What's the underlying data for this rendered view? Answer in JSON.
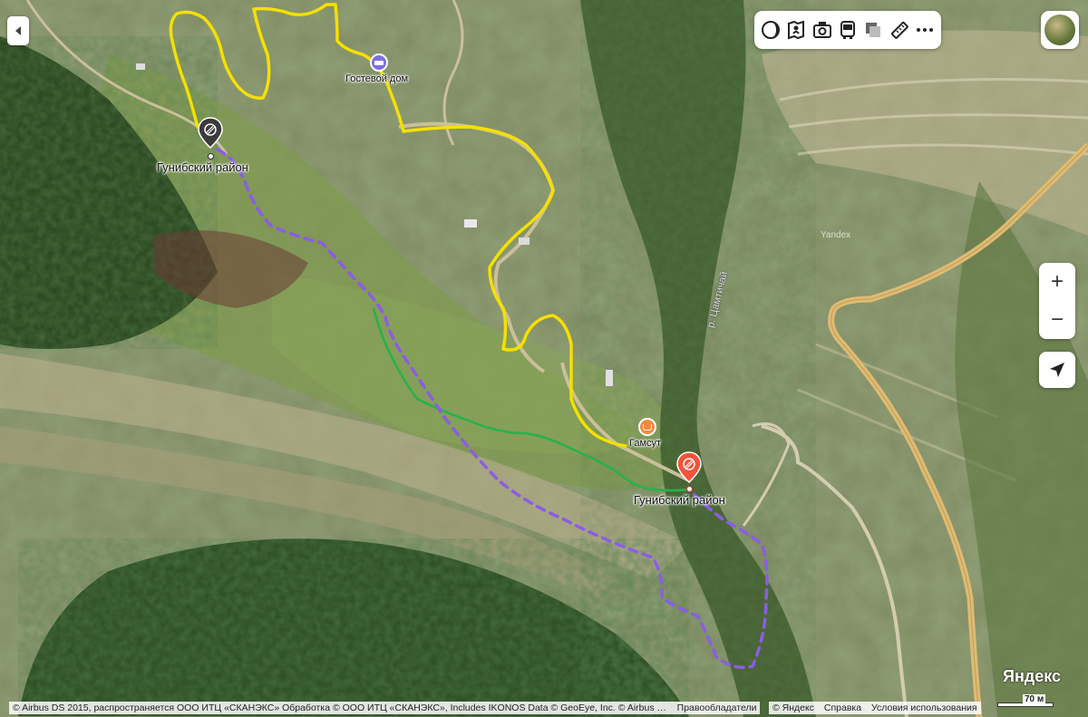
{
  "map": {
    "type": "satellite",
    "colors": {
      "route_yellow": "#f5e000",
      "route_green": "#24b34a",
      "route_purple": "#8c5ce6",
      "road_major": "#e0bb72",
      "pin_gray": "#3b3b3b",
      "pin_red": "#f1533b"
    }
  },
  "places": {
    "guest_house": "Гостевой дом",
    "gamsut": "Гамсут",
    "district_start": "Гунибский район",
    "district_end": "Гунибский район",
    "river": "р. Цамтичай",
    "watermark": "Yandex"
  },
  "controls": {
    "back_icon": "triangle-left-icon",
    "toolbar_icons": [
      "layers-icon",
      "panorama-icon",
      "photo-camera-icon",
      "transport-bus-icon",
      "map-mode-icon",
      "ruler-icon",
      "more-icon"
    ],
    "zoom_in": "+",
    "zoom_out": "−",
    "locate_icon": "location-arrow-icon"
  },
  "footer": {
    "attribution": "© Airbus DS 2015, распространяется ООО ИТЦ «СКАНЭКС» Обработка © ООО ИТЦ «СКАНЭКС», Includes IKONOS Data © GeoEye, Inc. © Airbus …",
    "rights_holders": "Правообладатели",
    "copyright": "© Яндекс",
    "help": "Справка",
    "terms": "Условия использования",
    "logo_main": "Яндекс",
    "scale": "70 м"
  }
}
